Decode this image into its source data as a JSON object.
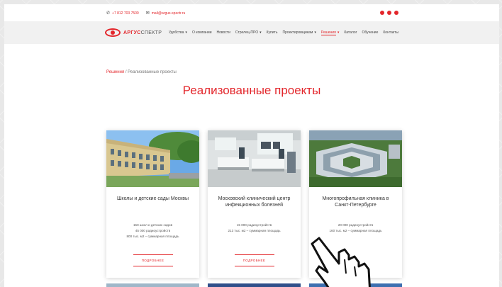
{
  "topbar": {
    "phone": "+7 812 703 7500",
    "email": "mail@argus-spectr.ru"
  },
  "header": {
    "logo_main": "АРГУС",
    "logo_sub": "СПЕКТР",
    "nav": [
      {
        "label": "Удобства",
        "dropdown": true
      },
      {
        "label": "О компании",
        "dropdown": false
      },
      {
        "label": "Новости",
        "dropdown": false
      },
      {
        "label": "Стрелец-ПРО",
        "dropdown": true
      },
      {
        "label": "Купить",
        "dropdown": false
      },
      {
        "label": "Проектировщикам",
        "dropdown": true
      },
      {
        "label": "Решения",
        "dropdown": true,
        "active": true
      },
      {
        "label": "Каталог",
        "dropdown": false
      },
      {
        "label": "Обучение",
        "dropdown": false
      },
      {
        "label": "Контакты",
        "dropdown": false
      }
    ]
  },
  "breadcrumb": {
    "home": "Решения",
    "separator": "/",
    "current": "Реализованные проекты"
  },
  "page_title": "Реализованные проекты",
  "cards": [
    {
      "title": "Школы и детские сады Москвы",
      "lines": [
        "150 школ и детских садов",
        "45 000 радиоустройств",
        "800 тыс. м2 – суммарная площадь"
      ],
      "button": "ПОДРОБНЕЕ"
    },
    {
      "title": "Московский клинический центр инфекционных болезней",
      "lines": [
        "15 000 радиоустройств",
        "213 тыс. м2 – суммарная площадь"
      ],
      "button": "ПОДРОБНЕЕ"
    },
    {
      "title": "Многопрофильная клиника в Санкт-Петербурге",
      "lines": [
        "20 000 радиоустройств",
        "160 тыс. м2 – суммарная площадь"
      ],
      "button": "ПОДРОБНЕЕ"
    }
  ],
  "colors": {
    "accent": "#e3262b",
    "header_bg": "#f1f1f1"
  },
  "icons": {
    "phone": "phone-icon",
    "mail": "mail-icon",
    "cursor": "hand-pointer-icon"
  }
}
